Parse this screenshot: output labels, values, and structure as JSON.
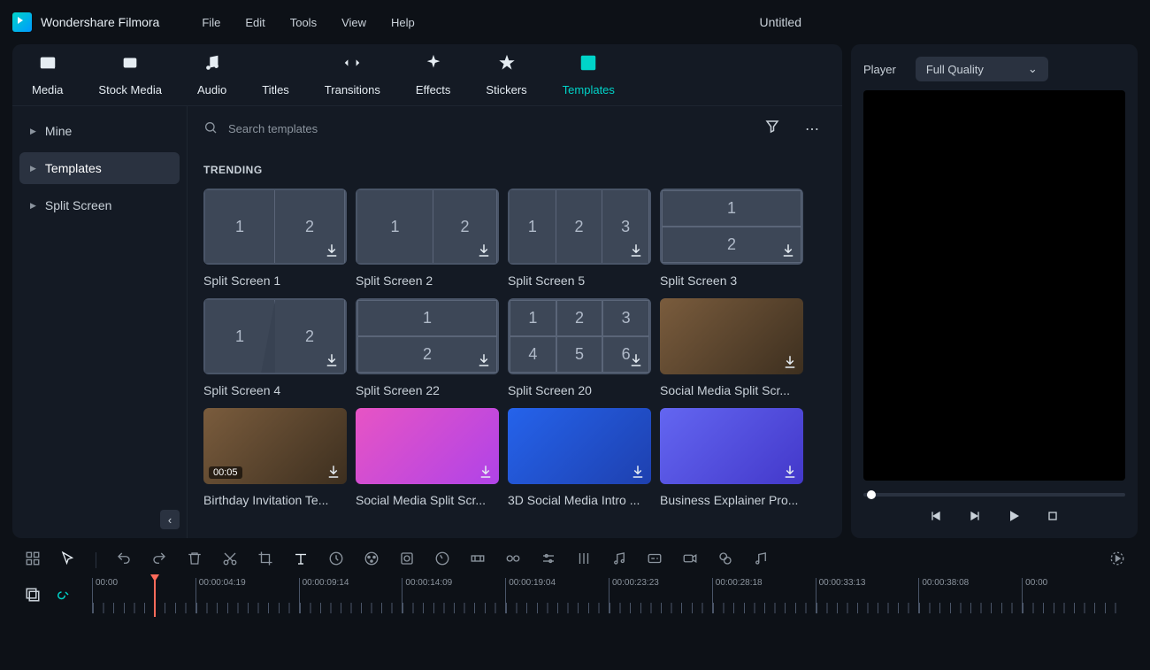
{
  "app": {
    "name": "Wondershare Filmora",
    "project": "Untitled"
  },
  "menubar": [
    "File",
    "Edit",
    "Tools",
    "View",
    "Help"
  ],
  "main_tabs": [
    {
      "label": "Media",
      "icon": "image-icon"
    },
    {
      "label": "Stock Media",
      "icon": "cloud-image-icon"
    },
    {
      "label": "Audio",
      "icon": "music-note-icon"
    },
    {
      "label": "Titles",
      "icon": "text-icon"
    },
    {
      "label": "Transitions",
      "icon": "swap-icon"
    },
    {
      "label": "Effects",
      "icon": "sparkle-icon"
    },
    {
      "label": "Stickers",
      "icon": "star-icon"
    },
    {
      "label": "Templates",
      "icon": "template-icon",
      "active": true
    }
  ],
  "sidebar": {
    "items": [
      {
        "label": "Mine"
      },
      {
        "label": "Templates",
        "active": true
      },
      {
        "label": "Split Screen"
      }
    ]
  },
  "search": {
    "placeholder": "Search templates"
  },
  "section_heading": "TRENDING",
  "templates": [
    {
      "label": "Split Screen 1",
      "layout": "2x1"
    },
    {
      "label": "Split Screen 2",
      "layout": "2x1-offset"
    },
    {
      "label": "Split Screen 5",
      "layout": "3x1"
    },
    {
      "label": "Split Screen 3",
      "layout": "1x2"
    },
    {
      "label": "Split Screen 4",
      "layout": "2x1-diag"
    },
    {
      "label": "Split Screen 22",
      "layout": "1-over-1"
    },
    {
      "label": "Split Screen 20",
      "layout": "3x2"
    },
    {
      "label": "Social Media Split Scr...",
      "layout": "photo"
    },
    {
      "label": "Birthday Invitation Te...",
      "layout": "photo",
      "duration": "00:05"
    },
    {
      "label": "Social Media Split Scr...",
      "layout": "photo-pink"
    },
    {
      "label": "3D Social Media Intro ...",
      "layout": "photo-blue"
    },
    {
      "label": "Business Explainer Pro...",
      "layout": "photo-purple"
    }
  ],
  "player": {
    "label": "Player",
    "quality": "Full Quality"
  },
  "timeline": {
    "marks": [
      "00:00",
      "00:00:04:19",
      "00:00:09:14",
      "00:00:14:09",
      "00:00:19:04",
      "00:00:23:23",
      "00:00:28:18",
      "00:00:33:13",
      "00:00:38:08",
      "00:00"
    ]
  }
}
